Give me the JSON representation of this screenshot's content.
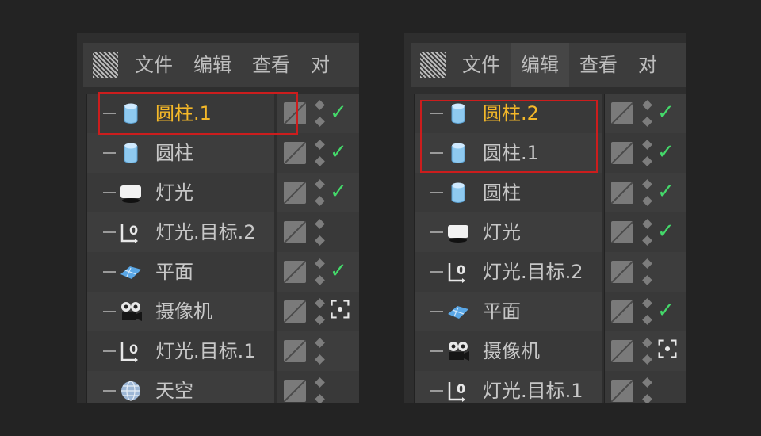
{
  "menu": {
    "icon": "grid-grip-icon",
    "items": [
      "文件",
      "编辑",
      "查看",
      "对"
    ]
  },
  "colors": {
    "selected": "#f4b829",
    "highlight": "#cc1d1d",
    "check": "#44d96a"
  },
  "left": {
    "active_menu": -1,
    "rows": [
      {
        "name": "圆柱.1",
        "icon": "cylinder-icon",
        "selected": true,
        "status": "check"
      },
      {
        "name": "圆柱",
        "icon": "cylinder-icon",
        "selected": false,
        "status": "check"
      },
      {
        "name": "灯光",
        "icon": "light-icon",
        "selected": false,
        "status": "check"
      },
      {
        "name": "灯光.目标.2",
        "icon": "target-tag-icon",
        "selected": false,
        "status": ""
      },
      {
        "name": "平面",
        "icon": "plane-icon",
        "selected": false,
        "status": "check"
      },
      {
        "name": "摄像机",
        "icon": "camera-icon",
        "selected": false,
        "status": "focus"
      },
      {
        "name": "灯光.目标.1",
        "icon": "target-tag-icon",
        "selected": false,
        "status": ""
      },
      {
        "name": "天空",
        "icon": "sky-sphere-icon",
        "selected": false,
        "status": ""
      }
    ]
  },
  "right": {
    "active_menu": 1,
    "rows": [
      {
        "name": "圆柱.2",
        "icon": "cylinder-icon",
        "selected": true,
        "status": "check"
      },
      {
        "name": "圆柱.1",
        "icon": "cylinder-icon",
        "selected": false,
        "status": "check"
      },
      {
        "name": "圆柱",
        "icon": "cylinder-icon",
        "selected": false,
        "status": "check"
      },
      {
        "name": "灯光",
        "icon": "light-icon",
        "selected": false,
        "status": "check"
      },
      {
        "name": "灯光.目标.2",
        "icon": "target-tag-icon",
        "selected": false,
        "status": ""
      },
      {
        "name": "平面",
        "icon": "plane-icon",
        "selected": false,
        "status": "check"
      },
      {
        "name": "摄像机",
        "icon": "camera-icon",
        "selected": false,
        "status": "focus"
      },
      {
        "name": "灯光.目标.1",
        "icon": "target-tag-icon",
        "selected": false,
        "status": ""
      }
    ]
  }
}
